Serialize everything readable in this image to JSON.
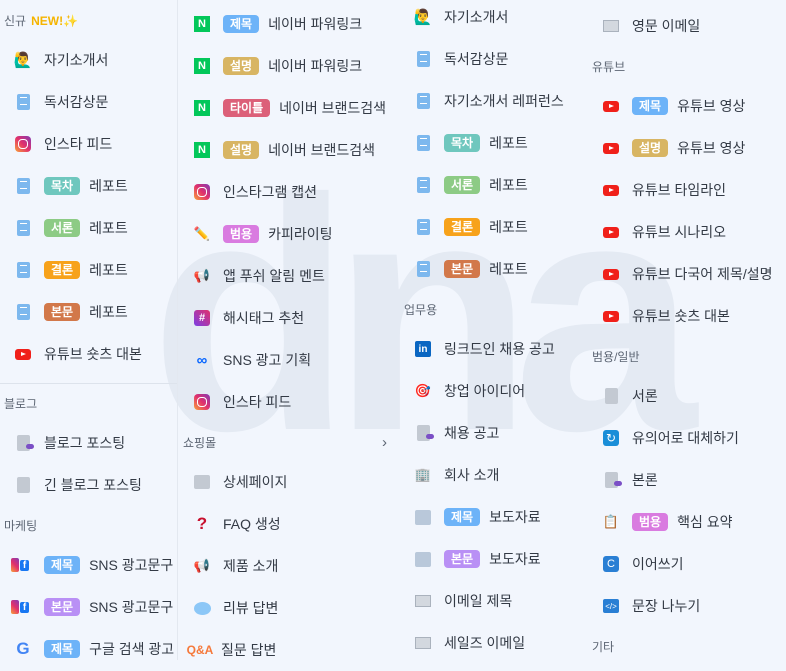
{
  "watermark": "dna",
  "badge_colors": {
    "제목": "#6db3f8",
    "설명": "#d8b563",
    "타이틀": "#dc6079",
    "범용": "#d97be0",
    "목차": "#6fc7be",
    "서론": "#8dcb85",
    "결론": "#f7a21b",
    "본문": "#d2784a",
    "본문2": "#b990f5"
  },
  "columns": [
    {
      "entries": [
        {
          "type": "section",
          "label": "신규",
          "new": "NEW!✨"
        },
        {
          "type": "item",
          "icon": "person",
          "label": "자기소개서"
        },
        {
          "type": "item",
          "icon": "doc",
          "label": "독서감상문"
        },
        {
          "type": "item",
          "icon": "instagram",
          "label": "인스타 피드"
        },
        {
          "type": "item",
          "icon": "doc",
          "badge": "목차",
          "label": "레포트"
        },
        {
          "type": "item",
          "icon": "doc",
          "badge": "서론",
          "label": "레포트"
        },
        {
          "type": "item",
          "icon": "doc",
          "badge": "결론",
          "label": "레포트"
        },
        {
          "type": "item",
          "icon": "doc",
          "badge": "본문",
          "label": "레포트"
        },
        {
          "type": "item",
          "icon": "youtube",
          "label": "유튜브 숏츠 대본"
        },
        {
          "type": "divider"
        },
        {
          "type": "section",
          "label": "블로그"
        },
        {
          "type": "item",
          "icon": "blog",
          "label": "블로그 포스팅"
        },
        {
          "type": "item",
          "icon": "file",
          "label": "긴 블로그 포스팅"
        },
        {
          "type": "section",
          "label": "마케팅"
        },
        {
          "type": "item",
          "icon": "sns",
          "badge": "제목",
          "label": "SNS 광고문구"
        },
        {
          "type": "item",
          "icon": "sns",
          "badge": "본문",
          "badge_color": "본문2",
          "label": "SNS 광고문구"
        },
        {
          "type": "item",
          "icon": "google",
          "badge": "제목",
          "label": "구글 검색 광고"
        }
      ]
    },
    {
      "entries": [
        {
          "type": "item",
          "icon": "naver",
          "badge": "제목",
          "label": "네이버 파워링크"
        },
        {
          "type": "item",
          "icon": "naver",
          "badge": "설명",
          "label": "네이버 파워링크"
        },
        {
          "type": "item",
          "icon": "naver",
          "badge": "타이틀",
          "label": "네이버 브랜드검색"
        },
        {
          "type": "item",
          "icon": "naver",
          "badge": "설명",
          "label": "네이버 브랜드검색"
        },
        {
          "type": "item",
          "icon": "instagram",
          "label": "인스타그램 캡션"
        },
        {
          "type": "item",
          "icon": "pencil",
          "badge": "범용",
          "label": "카피라이팅"
        },
        {
          "type": "item",
          "icon": "megaphone",
          "label": "앱 푸쉬 알림 멘트"
        },
        {
          "type": "item",
          "icon": "hashtag",
          "label": "해시태그 추천"
        },
        {
          "type": "item",
          "icon": "meta",
          "label": "SNS 광고 기획"
        },
        {
          "type": "item",
          "icon": "instagram",
          "label": "인스타 피드"
        },
        {
          "type": "section",
          "label": "쇼핑몰",
          "chevron": "›"
        },
        {
          "type": "item",
          "icon": "detail-page",
          "label": "상세페이지"
        },
        {
          "type": "item",
          "icon": "question",
          "label": "FAQ 생성"
        },
        {
          "type": "item",
          "icon": "loudspeaker",
          "label": "제품 소개"
        },
        {
          "type": "item",
          "icon": "speech-bubble",
          "label": "리뷰 답변"
        },
        {
          "type": "item",
          "icon": "qa",
          "icon_text": "Q&A",
          "label": "질문 답변"
        }
      ]
    },
    {
      "entries": [
        {
          "type": "item",
          "icon": "person",
          "label": "자기소개서"
        },
        {
          "type": "item",
          "icon": "doc",
          "label": "독서감상문"
        },
        {
          "type": "item",
          "icon": "doc",
          "label": "자기소개서 레퍼런스"
        },
        {
          "type": "item",
          "icon": "doc",
          "badge": "목차",
          "label": "레포트"
        },
        {
          "type": "item",
          "icon": "doc",
          "badge": "서론",
          "label": "레포트"
        },
        {
          "type": "item",
          "icon": "doc",
          "badge": "결론",
          "label": "레포트"
        },
        {
          "type": "item",
          "icon": "doc",
          "badge": "본문",
          "label": "레포트"
        },
        {
          "type": "section",
          "label": "업무용"
        },
        {
          "type": "item",
          "icon": "linkedin",
          "label": "링크드인 채용 공고"
        },
        {
          "type": "item",
          "icon": "target",
          "label": "창업 아이디어"
        },
        {
          "type": "item",
          "icon": "blog",
          "label": "채용 공고"
        },
        {
          "type": "item",
          "icon": "building",
          "label": "회사 소개"
        },
        {
          "type": "item",
          "icon": "newspaper",
          "badge": "제목",
          "label": "보도자료"
        },
        {
          "type": "item",
          "icon": "newspaper",
          "badge": "본문",
          "badge_color": "본문2",
          "label": "보도자료"
        },
        {
          "type": "item",
          "icon": "envelope",
          "label": "이메일 제목"
        },
        {
          "type": "item",
          "icon": "envelope",
          "label": "세일즈 이메일"
        }
      ]
    },
    {
      "entries": [
        {
          "type": "item",
          "icon": "envelope",
          "label": "영문 이메일"
        },
        {
          "type": "section",
          "label": "유튜브"
        },
        {
          "type": "item",
          "icon": "youtube",
          "badge": "제목",
          "label": "유튜브 영상"
        },
        {
          "type": "item",
          "icon": "youtube",
          "badge": "설명",
          "label": "유튜브 영상"
        },
        {
          "type": "item",
          "icon": "youtube",
          "label": "유튜브 타임라인"
        },
        {
          "type": "item",
          "icon": "youtube",
          "label": "유튜브 시나리오"
        },
        {
          "type": "item",
          "icon": "youtube",
          "label": "유튜브 다국어 제목/설명"
        },
        {
          "type": "item",
          "icon": "youtube",
          "label": "유튜브 숏츠 대본"
        },
        {
          "type": "section",
          "label": "범용/일반"
        },
        {
          "type": "item",
          "icon": "file",
          "label": "서론"
        },
        {
          "type": "item",
          "icon": "refresh",
          "label": "유의어로 대체하기"
        },
        {
          "type": "item",
          "icon": "blog",
          "label": "본론"
        },
        {
          "type": "item",
          "icon": "clipboard",
          "badge": "범용",
          "label": "핵심 요약"
        },
        {
          "type": "item",
          "icon": "continue",
          "label": "이어쓰기"
        },
        {
          "type": "item",
          "icon": "split",
          "label": "문장 나누기"
        },
        {
          "type": "section",
          "label": "기타"
        }
      ]
    }
  ]
}
